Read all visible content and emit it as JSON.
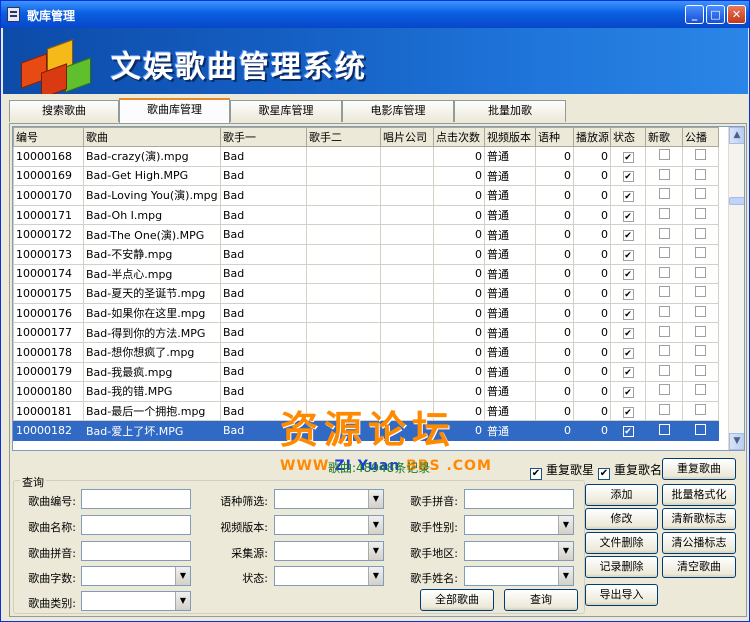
{
  "window": {
    "title": "歌库管理"
  },
  "banner": {
    "title": "文娱歌曲管理系统"
  },
  "tabs": [
    {
      "label": "搜索歌曲"
    },
    {
      "label": "歌曲库管理"
    },
    {
      "label": "歌星库管理"
    },
    {
      "label": "电影库管理"
    },
    {
      "label": "批量加歌"
    }
  ],
  "table": {
    "columns": [
      "编号",
      "歌曲",
      "歌手一",
      "歌手二",
      "唱片公司",
      "点击次数",
      "视频版本",
      "语种",
      "播放源",
      "状态",
      "新歌",
      "公播"
    ],
    "rows": [
      {
        "id": "10000168",
        "song": "Bad-crazy(演).mpg",
        "singer1": "Bad",
        "singer2": "",
        "company": "",
        "clicks": "0",
        "video": "普通",
        "lang": "0",
        "source": "0",
        "status": true,
        "newsong": false,
        "public": false
      },
      {
        "id": "10000169",
        "song": "Bad-Get High.MPG",
        "singer1": "Bad",
        "singer2": "",
        "company": "",
        "clicks": "0",
        "video": "普通",
        "lang": "0",
        "source": "0",
        "status": true,
        "newsong": false,
        "public": false
      },
      {
        "id": "10000170",
        "song": "Bad-Loving You(演).mpg",
        "singer1": "Bad",
        "singer2": "",
        "company": "",
        "clicks": "0",
        "video": "普通",
        "lang": "0",
        "source": "0",
        "status": true,
        "newsong": false,
        "public": false
      },
      {
        "id": "10000171",
        "song": "Bad-Oh I.mpg",
        "singer1": "Bad",
        "singer2": "",
        "company": "",
        "clicks": "0",
        "video": "普通",
        "lang": "0",
        "source": "0",
        "status": true,
        "newsong": false,
        "public": false
      },
      {
        "id": "10000172",
        "song": "Bad-The One(演).MPG",
        "singer1": "Bad",
        "singer2": "",
        "company": "",
        "clicks": "0",
        "video": "普通",
        "lang": "0",
        "source": "0",
        "status": true,
        "newsong": false,
        "public": false
      },
      {
        "id": "10000173",
        "song": "Bad-不安静.mpg",
        "singer1": "Bad",
        "singer2": "",
        "company": "",
        "clicks": "0",
        "video": "普通",
        "lang": "0",
        "source": "0",
        "status": true,
        "newsong": false,
        "public": false
      },
      {
        "id": "10000174",
        "song": "Bad-半点心.mpg",
        "singer1": "Bad",
        "singer2": "",
        "company": "",
        "clicks": "0",
        "video": "普通",
        "lang": "0",
        "source": "0",
        "status": true,
        "newsong": false,
        "public": false
      },
      {
        "id": "10000175",
        "song": "Bad-夏天的圣诞节.mpg",
        "singer1": "Bad",
        "singer2": "",
        "company": "",
        "clicks": "0",
        "video": "普通",
        "lang": "0",
        "source": "0",
        "status": true,
        "newsong": false,
        "public": false
      },
      {
        "id": "10000176",
        "song": "Bad-如果你在这里.mpg",
        "singer1": "Bad",
        "singer2": "",
        "company": "",
        "clicks": "0",
        "video": "普通",
        "lang": "0",
        "source": "0",
        "status": true,
        "newsong": false,
        "public": false
      },
      {
        "id": "10000177",
        "song": "Bad-得到你的方法.MPG",
        "singer1": "Bad",
        "singer2": "",
        "company": "",
        "clicks": "0",
        "video": "普通",
        "lang": "0",
        "source": "0",
        "status": true,
        "newsong": false,
        "public": false
      },
      {
        "id": "10000178",
        "song": "Bad-想你想疯了.mpg",
        "singer1": "Bad",
        "singer2": "",
        "company": "",
        "clicks": "0",
        "video": "普通",
        "lang": "0",
        "source": "0",
        "status": true,
        "newsong": false,
        "public": false
      },
      {
        "id": "10000179",
        "song": "Bad-我最疯.mpg",
        "singer1": "Bad",
        "singer2": "",
        "company": "",
        "clicks": "0",
        "video": "普通",
        "lang": "0",
        "source": "0",
        "status": true,
        "newsong": false,
        "public": false
      },
      {
        "id": "10000180",
        "song": "Bad-我的错.MPG",
        "singer1": "Bad",
        "singer2": "",
        "company": "",
        "clicks": "0",
        "video": "普通",
        "lang": "0",
        "source": "0",
        "status": true,
        "newsong": false,
        "public": false
      },
      {
        "id": "10000181",
        "song": "Bad-最后一个拥抱.mpg",
        "singer1": "Bad",
        "singer2": "",
        "company": "",
        "clicks": "0",
        "video": "普通",
        "lang": "0",
        "source": "0",
        "status": true,
        "newsong": false,
        "public": false
      },
      {
        "id": "10000182",
        "song": "Bad-爱上了坏.MPG",
        "singer1": "Bad",
        "singer2": "",
        "company": "",
        "clicks": "0",
        "video": "普通",
        "lang": "0",
        "source": "0",
        "status": true,
        "newsong": false,
        "public": false
      }
    ]
  },
  "watermark": {
    "line1": "资源论坛",
    "line2a": "WWW.",
    "line2b": "ZI",
    "line2c": " Yuan ",
    "line2d": "BBS",
    "line2e": " .COM"
  },
  "status": {
    "count": "歌曲:48948条记录"
  },
  "options": {
    "dup_singer": "重复歌星",
    "dup_song": "重复歌名"
  },
  "query": {
    "legend": "查询",
    "song_id": "歌曲编号:",
    "song_name": "歌曲名称:",
    "song_pinyin": "歌曲拼音:",
    "song_chars": "歌曲字数:",
    "song_type": "歌曲类别:",
    "lang_filter": "语种筛选:",
    "video_version": "视频版本:",
    "source": "采集源:",
    "status": "状态:",
    "singer_pinyin": "歌手拼音:",
    "singer_gender": "歌手性别:",
    "singer_region": "歌手地区:",
    "singer_name": "歌手姓名:",
    "all_songs": "全部歌曲",
    "search": "查询"
  },
  "actions": {
    "dup_songs": "重复歌曲",
    "add": "添加",
    "batch_format": "批量格式化",
    "edit": "修改",
    "clear_new": "清新歌标志",
    "file_delete": "文件删除",
    "clear_public": "清公播标志",
    "record_delete": "记录删除",
    "clear_songs": "清空歌曲",
    "import_export": "导出导入"
  }
}
